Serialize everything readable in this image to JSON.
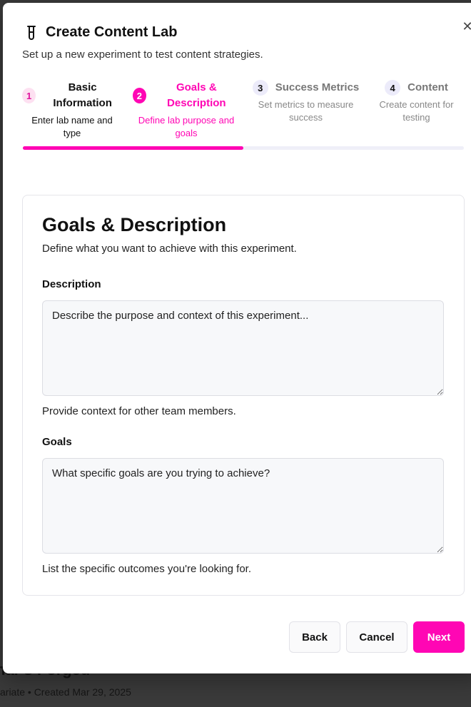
{
  "background": {
    "title": "har's Forged",
    "meta": "ariate • Created Mar 29, 2025"
  },
  "dialog": {
    "title": "Create Content Lab",
    "subtitle": "Set up a new experiment to test content strategies.",
    "close_icon": "close-icon",
    "title_icon": "flask-icon"
  },
  "steps": [
    {
      "number": "1",
      "label": "Basic Information",
      "description": "Enter lab name and type",
      "state": "completed"
    },
    {
      "number": "2",
      "label": "Goals & Description",
      "description": "Define lab purpose and goals",
      "state": "active"
    },
    {
      "number": "3",
      "label": "Success Metrics",
      "description": "Set metrics to measure success",
      "state": "upcoming"
    },
    {
      "number": "4",
      "label": "Content",
      "description": "Create content for testing",
      "state": "upcoming"
    }
  ],
  "progress": {
    "fraction": 0.5
  },
  "section": {
    "title": "Goals & Description",
    "description": "Define what you want to achieve with this experiment.",
    "description_field": {
      "label": "Description",
      "value": "",
      "placeholder": "Describe the purpose and context of this experiment...",
      "help": "Provide context for other team members."
    },
    "goals_field": {
      "label": "Goals",
      "value": "",
      "placeholder": "What specific goals are you trying to achieve?",
      "help": "List the specific outcomes you're looking for."
    }
  },
  "actions": {
    "back": "Back",
    "cancel": "Cancel",
    "next": "Next"
  },
  "colors": {
    "accent": "#ff06b4",
    "accent_light": "#fde0f1",
    "inactive_circle": "#ecebfa"
  }
}
